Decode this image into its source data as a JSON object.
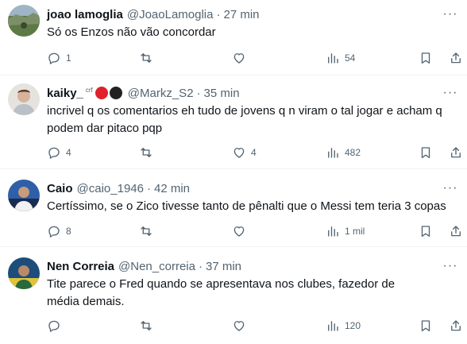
{
  "tweets": [
    {
      "name": "joao lamoglia",
      "handle": "@JoaoLamoglia",
      "time": "27 min",
      "text": "Só os Enzos não vão concordar",
      "replies": "1",
      "retweets": "",
      "likes": "",
      "views": "54",
      "avatar_colors": [
        "#6f8aa3",
        "#4f6b3a"
      ]
    },
    {
      "name": "kaiky_",
      "badge_text": "crf",
      "badge_colors": [
        "#e0202a",
        "#222222"
      ],
      "handle": "@Markz_S2",
      "time": "35 min",
      "text": "incrivel q os comentarios eh tudo de jovens q n viram o tal jogar e acham q podem dar pitaco pqp",
      "replies": "4",
      "retweets": "",
      "likes": "4",
      "views": "482",
      "avatar_colors": [
        "#e9e6e1",
        "#c9a48a"
      ]
    },
    {
      "name": "Caio",
      "handle": "@caio_1946",
      "time": "42 min",
      "text": "Certíssimo, se o Zico tivesse tanto de pênalti que o Messi tem teria 3 copas",
      "replies": "8",
      "retweets": "",
      "likes": "",
      "views": "1 mil",
      "avatar_colors": [
        "#2c5aa0",
        "#1b2c4f"
      ]
    },
    {
      "name": "Nen Correia",
      "handle": "@Nen_correia",
      "time": "37 min",
      "text": "Tite parece o Fred quando se apresentava nos clubes, fazedor de média demais.",
      "replies": "",
      "retweets": "",
      "likes": "",
      "views": "120",
      "avatar_colors": [
        "#1d4d7a",
        "#e0c33c"
      ]
    }
  ],
  "more_glyph": "···",
  "separator": "·"
}
